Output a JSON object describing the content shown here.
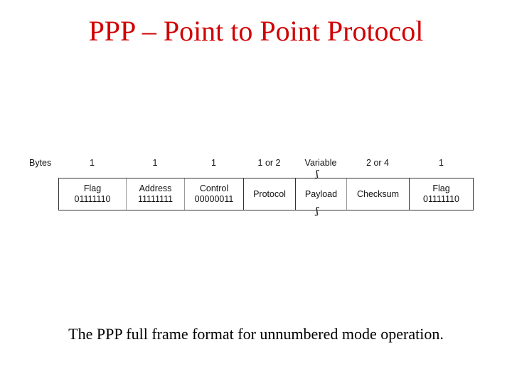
{
  "title": "PPP – Point to Point Protocol",
  "caption": "The PPP full frame format for unnumbered mode operation.",
  "colors": {
    "title": "#d10000",
    "text": "#111111",
    "border": "#333333"
  },
  "diagram": {
    "bytes_label": "Bytes",
    "fields": [
      {
        "name": "Flag",
        "value": "01111110",
        "bytes": "1"
      },
      {
        "name": "Address",
        "value": "11111111",
        "bytes": "1"
      },
      {
        "name": "Control",
        "value": "00000011",
        "bytes": "1"
      },
      {
        "name": "Protocol",
        "value": "",
        "bytes": "1 or 2"
      },
      {
        "name": "Payload",
        "value": "",
        "bytes": "Variable"
      },
      {
        "name": "Checksum",
        "value": "",
        "bytes": "2 or 4"
      },
      {
        "name": "Flag",
        "value": "01111110",
        "bytes": "1"
      }
    ],
    "break_marks": {
      "field": "Payload",
      "symbol": "ʃʃ"
    }
  }
}
